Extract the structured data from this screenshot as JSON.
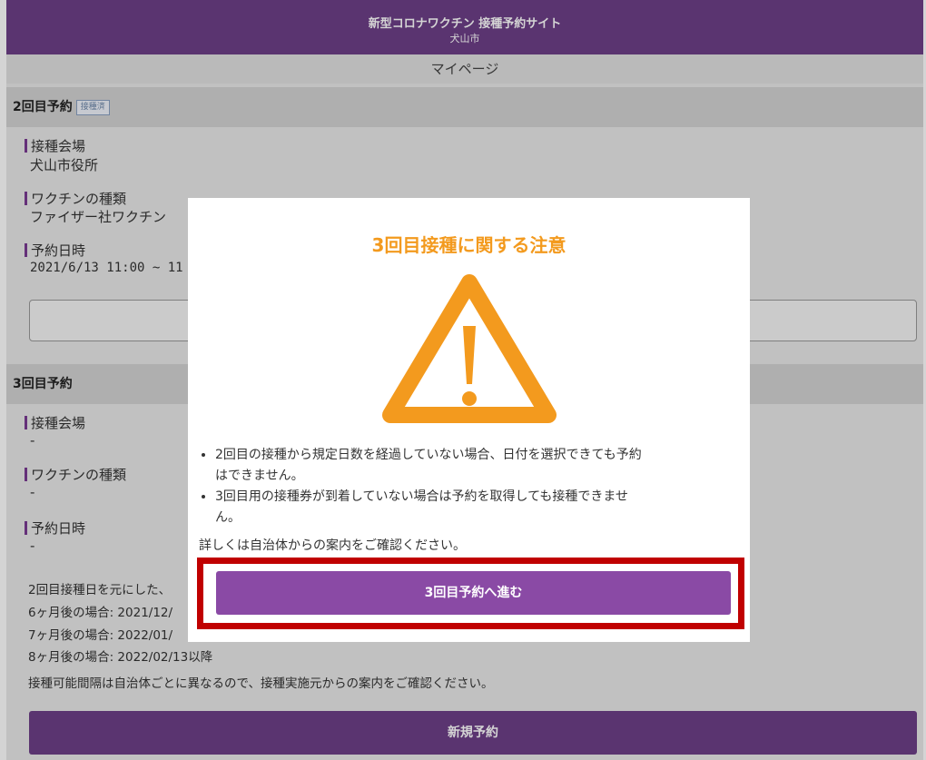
{
  "header": {
    "title": "新型コロナワクチン 接種予約サイト",
    "city": "犬山市"
  },
  "subheader": {
    "label": "マイページ"
  },
  "second": {
    "title": "2回目予約",
    "badge": "接種済",
    "venue_label": "接種会場",
    "venue_value": "犬山市役所",
    "vaccine_label": "ワクチンの種類",
    "vaccine_value": "ファイザー社ワクチン",
    "datetime_label": "予約日時",
    "datetime_value": "2021/6/13 11:00 ~ 11"
  },
  "third": {
    "title": "3回目予約",
    "venue_label": "接種会場",
    "venue_value": "-",
    "vaccine_label": "ワクチンの種類",
    "vaccine_value": "-",
    "datetime_label": "予約日時",
    "datetime_value": "-",
    "info_line1": "2回目接種日を元にした、",
    "info_line2": "6ヶ月後の場合: 2021/12/",
    "info_line3": "7ヶ月後の場合: 2022/01/",
    "info_line4": "8ヶ月後の場合: 2022/02/13以降",
    "info_line5": "接種可能間隔は自治体ごとに異なるので、接種実施元からの案内をご確認ください。",
    "new_button": "新規予約"
  },
  "modal": {
    "title": "3回目接種に関する注意",
    "icon": "warning-triangle-icon",
    "note1_line1": "2回目の接種から規定日数を経過していない場合、日付を選択できても予約",
    "note1_line2": "はできません。",
    "note2_line1": "3回目用の接種券が到着していない場合は予約を取得しても接種できませ",
    "note2_line2": "ん。",
    "detail": "詳しくは自治体からの案内をご確認ください。",
    "proceed_button": "3回目予約へ進む"
  },
  "colors": {
    "brand": "#6d3f87",
    "button": "#8a4aa5",
    "warning": "#f39a1e",
    "highlight": "#c00000"
  }
}
